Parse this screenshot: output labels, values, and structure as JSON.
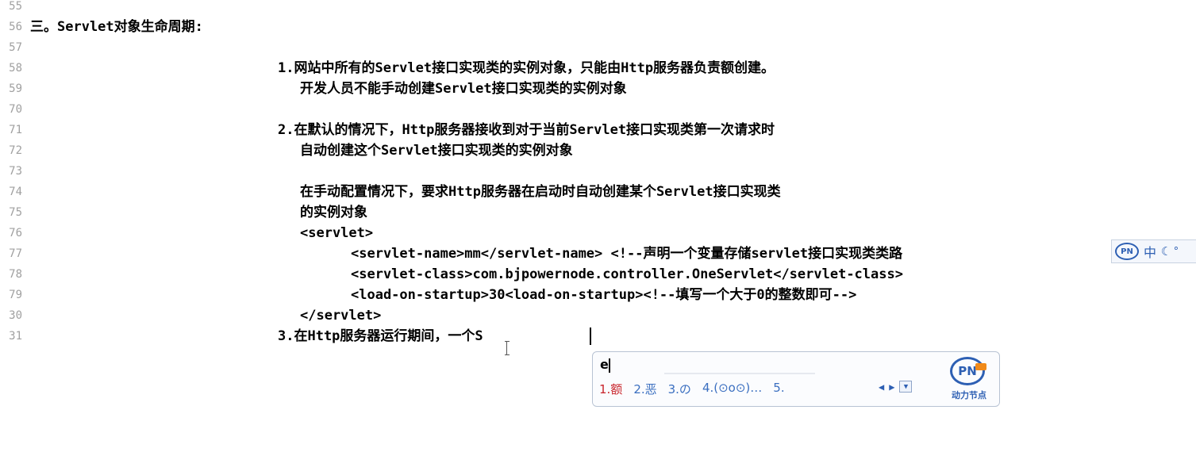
{
  "gutter": {
    "line_numbers": [
      "55",
      "56",
      "57",
      "58",
      "59",
      "70",
      "71",
      "72",
      "73",
      "74",
      "75",
      "76",
      "77",
      "78",
      "79",
      "30",
      "31"
    ]
  },
  "editor": {
    "lines": [
      "",
      "三。Servlet对象生命周期:",
      "",
      "1.网站中所有的Servlet接口实现类的实例对象，只能由Http服务器负责额创建。",
      "开发人员不能手动创建Servlet接口实现类的实例对象",
      "",
      "2.在默认的情况下，Http服务器接收到对于当前Servlet接口实现类第一次请求时",
      "自动创建这个Servlet接口实现类的实例对象",
      "",
      "在手动配置情况下，要求Http服务器在启动时自动创建某个Servlet接口实现类",
      "的实例对象",
      "<servlet>",
      "<servlet-name>mm</servlet-name> <!--声明一个变量存储servlet接口实现类类路",
      "<servlet-class>com.bjpowernode.controller.OneServlet</servlet-class>",
      "<load-on-startup>30<load-on-startup><!--填写一个大于0的整数即可-->",
      "</servlet>",
      "3.在Http服务器运行期间，一个S"
    ]
  },
  "ime_status": {
    "mode": "中",
    "logo": "PN"
  },
  "ime_candidate": {
    "composition": "e",
    "candidates": [
      "1.额",
      "2.恶",
      "3.の",
      "4.(⊙o⊙)…",
      "5."
    ],
    "brand_logo": "PN",
    "brand_name": "动力节点"
  },
  "colors": {
    "gutter_text": "#a0a0a0",
    "candidate_text": "#3b6fc0",
    "candidate_selected": "#c8232a",
    "ime_brand": "#2d5fb3"
  }
}
